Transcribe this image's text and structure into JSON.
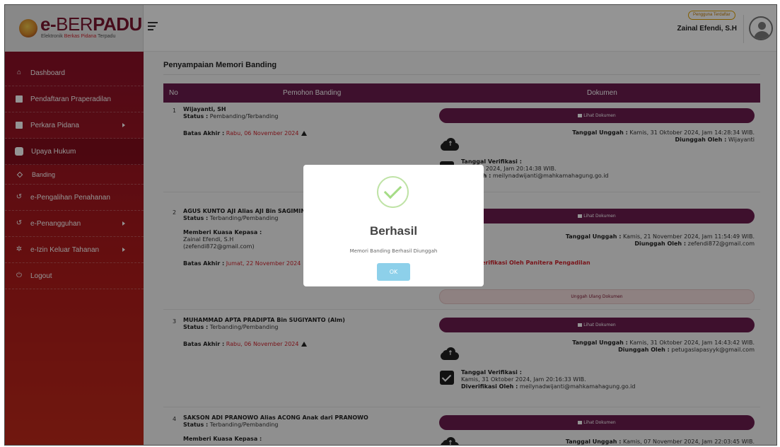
{
  "brand": {
    "name_prefix": "e-",
    "name_thin": "BER",
    "name_bold": "PADU",
    "tagline_a": "Elektronik ",
    "tagline_b": "Berkas Pidana",
    "tagline_c": " Terpadu"
  },
  "header": {
    "badge": "Pengguna Terdaftar",
    "user_name": "Zainal Efendi, S.H"
  },
  "sidebar": {
    "items": [
      {
        "label": "Dashboard"
      },
      {
        "label": "Pendaftaran Praperadilan"
      },
      {
        "label": "Perkara Pidana"
      },
      {
        "label": "Upaya Hukum"
      },
      {
        "label": "Banding"
      },
      {
        "label": "e-Pengalihan Penahanan"
      },
      {
        "label": "e-Penangguhan"
      },
      {
        "label": "e-Izin Keluar Tahanan"
      },
      {
        "label": "Logout"
      }
    ]
  },
  "page": {
    "title": "Penyampaian Memori Banding"
  },
  "table": {
    "headers": {
      "no": "No",
      "pemohon": "Pemohon Banding",
      "dokumen": "Dokumen"
    },
    "lihat_label": "Lihat Dokumen",
    "ulang_label": "Unggah Ulang Dokumen",
    "rows": [
      {
        "no": "1",
        "name": "Wijayanti, SH",
        "status_label": "Status :",
        "status": " Pembanding/Terbanding",
        "batas_label": "Batas Akhir :",
        "batas": " Rabu, 06 November 2024",
        "tgl_unggah_label": "Tanggal Unggah :",
        "tgl_unggah": " Kamis, 31 Oktober 2024, Jam 14:28:34 WIB.",
        "oleh_label": "Diunggah Oleh :",
        "oleh": " Wijayanti",
        "verif_label": "Tanggal Verifikasi :",
        "verif": "Oktober 2024, Jam 20:14:38 WIB.",
        "verif_oleh_label": "asi Oleh :",
        "verif_oleh": " meilynadwijanti@mahkamahagung.go.id"
      },
      {
        "no": "2",
        "name": "AGUS KUNTO AJI Alias AJI Bin SAGIMIN",
        "status_label": "Status :",
        "status": " Terbanding/Pembanding",
        "kuasa_label": "Memberi Kuasa Kepasa :",
        "kuasa_name": "Zainal Efendi, S.H",
        "kuasa_email": "(zefendi872@gmail.com)",
        "batas_label": "Batas Akhir :",
        "batas": " Jumat, 22 November 2024",
        "tgl_unggah_label": "Tanggal Unggah :",
        "tgl_unggah": " Kamis, 21 November 2024, Jam 11:54:49 WIB.",
        "oleh_label": "Diunggah Oleh :",
        "oleh": " zefendi872@gmail.com",
        "not_verified": "iverifikasi Oleh Panitera Pengadilan"
      },
      {
        "no": "3",
        "name": "MUHAMMAD APTA PRADIPTA Bin SUGIYANTO (Alm)",
        "status_label": "Status :",
        "status": " Terbanding/Pembanding",
        "batas_label": "Batas Akhir :",
        "batas": " Rabu, 06 November 2024",
        "tgl_unggah_label": "Tanggal Unggah :",
        "tgl_unggah": " Kamis, 31 Oktober 2024, Jam 14:43:42 WIB.",
        "oleh_label": "Diunggah Oleh :",
        "oleh": " petugaslapasyyk@gmail.com",
        "verif_label": "Tanggal Verifikasi :",
        "verif": "Kamis, 31 Oktober 2024, Jam 20:16:33 WIB.",
        "verif_oleh_label": "Diverifikasi Oleh :",
        "verif_oleh": " meilynadwijanti@mahkamahagung.go.id"
      },
      {
        "no": "4",
        "name": "SAKSON ADI PRANOWO Alias ACONG Anak dari PRANOWO",
        "status_label": "Status :",
        "status": " Terbanding/Pembanding",
        "kuasa_label": "Memberi Kuasa Kepasa :",
        "tgl_unggah_label": "Tanggal Unggah :",
        "tgl_unggah": " Kamis, 07 November 2024, Jam 22:03:45 WIB."
      }
    ]
  },
  "modal": {
    "title": "Berhasil",
    "message": "Memori Banding Berhasil Diunggah",
    "ok_label": "OK"
  },
  "colors": {
    "primary": "#6b1d4f",
    "sidebar_top": "#8b1028",
    "sidebar_bottom": "#c22a1a",
    "danger": "#d0252f",
    "ok_button": "#8dd0ea"
  }
}
